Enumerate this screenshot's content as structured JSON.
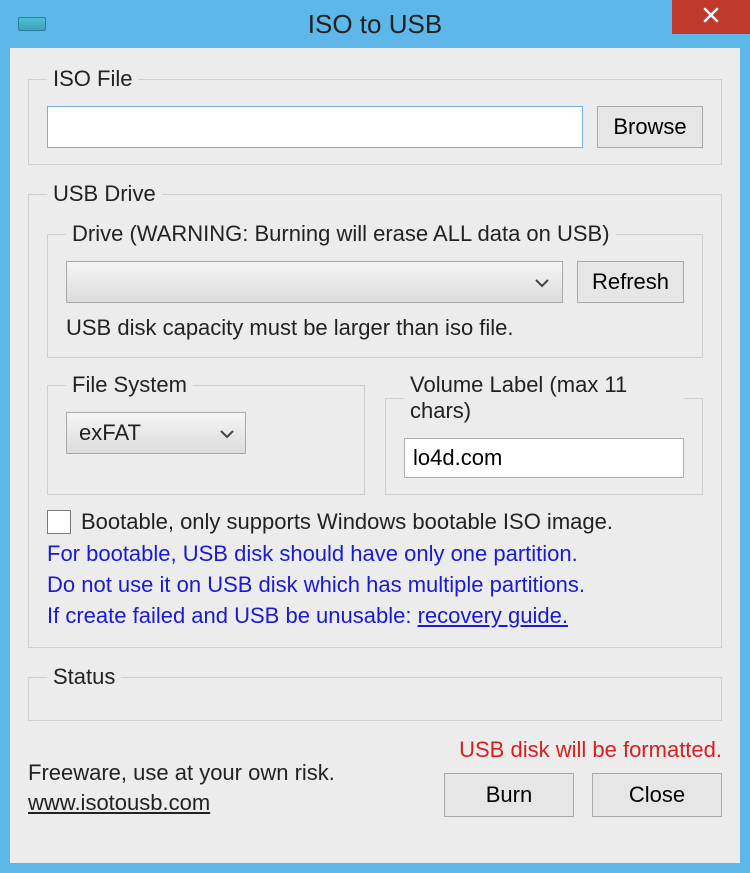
{
  "titlebar": {
    "title": "ISO to USB"
  },
  "iso": {
    "legend": "ISO File",
    "path": "",
    "browse_label": "Browse"
  },
  "usb": {
    "legend": "USB Drive",
    "drive_legend": "Drive (WARNING: Burning will erase ALL data on USB)",
    "refresh_label": "Refresh",
    "capacity_hint": "USB disk capacity must be larger than iso file.",
    "fs": {
      "legend": "File System",
      "value": "exFAT"
    },
    "vol": {
      "legend": "Volume Label (max 11 chars)",
      "value": "lo4d.com"
    },
    "bootable_label": "Bootable, only supports Windows bootable ISO image.",
    "note_line1": "For bootable, USB disk should have only one partition.",
    "note_line2": "Do not use it on USB disk which has multiple partitions.",
    "note_prefix": "If create failed and USB be unusable: ",
    "note_link": "recovery guide."
  },
  "status": {
    "legend": "Status"
  },
  "footer": {
    "freeware": "Freeware, use at your own risk.",
    "site": "www.isotousb.com",
    "warning": "USB disk will be formatted.",
    "burn_label": "Burn",
    "close_label": "Close"
  }
}
